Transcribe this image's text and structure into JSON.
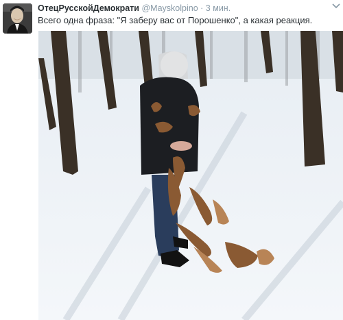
{
  "tweet": {
    "author_name": "ОтецРусскойДемократи",
    "handle": "@Mayskolpino",
    "separator": "·",
    "time": "3 мин.",
    "text": "Всего одна фраза: \"Я заберу вас от Порошенко\", а какая реакция.",
    "more_icon": "chevron-down-icon"
  },
  "media": {
    "description_icon": "photo"
  }
}
